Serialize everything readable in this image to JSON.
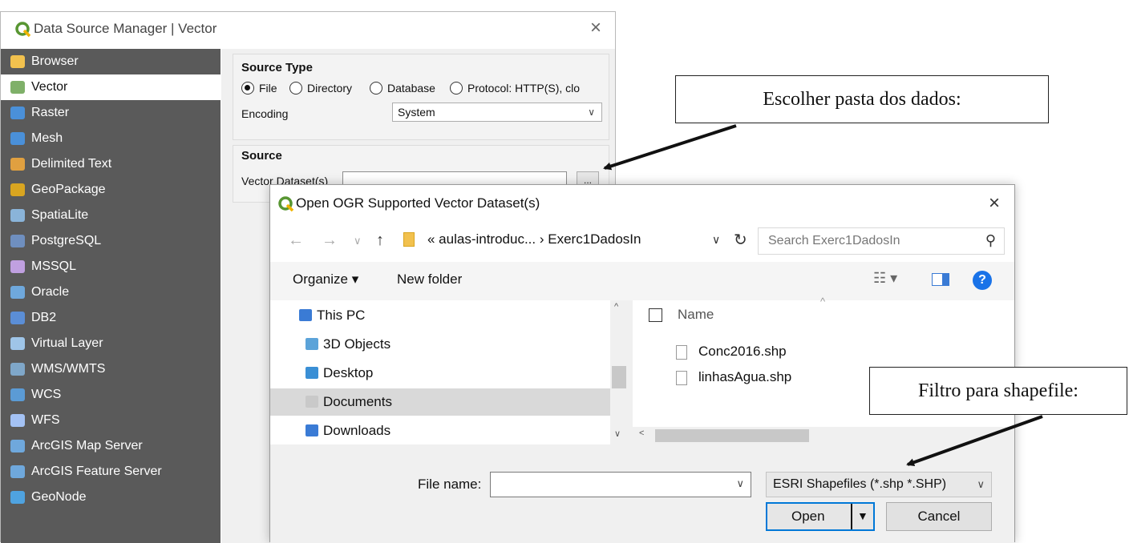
{
  "dsm": {
    "title": "Data Source Manager | Vector",
    "close_glyph": "×",
    "sidebar": [
      {
        "label": "Browser",
        "color": "#f2c14e"
      },
      {
        "label": "Vector",
        "color": "#7fb069"
      },
      {
        "label": "Raster",
        "color": "#4a90d9"
      },
      {
        "label": "Mesh",
        "color": "#4a90d9"
      },
      {
        "label": "Delimited Text",
        "color": "#e0a040"
      },
      {
        "label": "GeoPackage",
        "color": "#d9a520"
      },
      {
        "label": "SpatiaLite",
        "color": "#8ab4d9"
      },
      {
        "label": "PostgreSQL",
        "color": "#6f8fbf"
      },
      {
        "label": "MSSQL",
        "color": "#c0a0e0"
      },
      {
        "label": "Oracle",
        "color": "#6fa8dc"
      },
      {
        "label": "DB2",
        "color": "#5b8ed6"
      },
      {
        "label": "Virtual Layer",
        "color": "#9fc5e8"
      },
      {
        "label": "WMS/WMTS",
        "color": "#7fa7c9"
      },
      {
        "label": "WCS",
        "color": "#5b9bd5"
      },
      {
        "label": "WFS",
        "color": "#a4c2f4"
      },
      {
        "label": "ArcGIS Map Server",
        "color": "#6fa8dc"
      },
      {
        "label": "ArcGIS Feature Server",
        "color": "#6fa8dc"
      },
      {
        "label": "GeoNode",
        "color": "#4fa3e0"
      }
    ],
    "source_type": {
      "title": "Source Type",
      "options": [
        "File",
        "Directory",
        "Database",
        "Protocol: HTTP(S), clo"
      ],
      "encoding_label": "Encoding",
      "encoding_value": "System"
    },
    "source": {
      "title": "Source",
      "dataset_label": "Vector Dataset(s)",
      "browse_label": "..."
    }
  },
  "dialog": {
    "title": "Open OGR Supported Vector Dataset(s)",
    "close_glyph": "×",
    "nav": {
      "back": "←",
      "forward": "→",
      "recent": "∨",
      "up": "↑",
      "path": "« aulas-introduc... › Exerc1DadosIn",
      "search_placeholder": "Search Exerc1DadosIn"
    },
    "toolbar": {
      "organize": "Organize ▾",
      "new_folder": "New folder",
      "help": "?"
    },
    "nav_pane": [
      {
        "label": "This PC",
        "color": "#3a7bd5"
      },
      {
        "label": "3D Objects",
        "color": "#5ba3d9"
      },
      {
        "label": "Desktop",
        "color": "#3a8fd5"
      },
      {
        "label": "Documents",
        "color": "#c9c9c9"
      },
      {
        "label": "Downloads",
        "color": "#3a7bd5"
      }
    ],
    "files": {
      "column_name": "Name",
      "items": [
        "Conc2016.shp",
        "linhasAgua.shp"
      ]
    },
    "bottom": {
      "file_name_label": "File name:",
      "file_name_value": "",
      "filter": "ESRI Shapefiles (*.shp *.SHP)",
      "open": "Open",
      "cancel": "Cancel"
    }
  },
  "annotations": {
    "folder_note": "Escolher pasta dos dados:",
    "filter_note": "Filtro para shapefile:"
  }
}
